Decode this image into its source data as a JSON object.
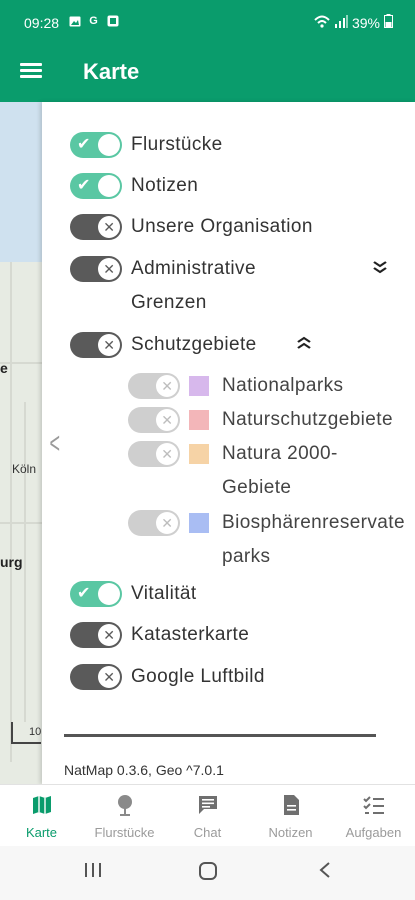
{
  "status": {
    "time": "09:28",
    "battery": "39%",
    "icons": [
      "image-icon",
      "g-icon",
      "app-icon"
    ]
  },
  "appbar": {
    "title": "Karte"
  },
  "map": {
    "labels": [
      "e",
      "Köln",
      "urg"
    ],
    "scale": "10"
  },
  "layers": [
    {
      "label": "Flurstücke",
      "state": "on"
    },
    {
      "label": "Notizen",
      "state": "on"
    },
    {
      "label": "Unsere Organisation",
      "state": "off"
    },
    {
      "label": "Administrative Grenzen",
      "state": "off",
      "chevron": "expand"
    },
    {
      "label": "Schutzgebiete",
      "state": "off",
      "chevron": "collapse"
    },
    {
      "label": "Vitalität",
      "state": "on"
    },
    {
      "label": "Katasterkarte",
      "state": "off"
    },
    {
      "label": "Google Luftbild",
      "state": "off"
    }
  ],
  "sublayers": [
    {
      "label": "Nationalparks",
      "color": "#d7b8ec"
    },
    {
      "label": "Naturschutzgebiete",
      "color": "#f3b6b9"
    },
    {
      "label": "Natura 2000-Gebiete",
      "color": "#f6d3a6"
    },
    {
      "label": "Biosphärenreservate parks",
      "color": "#a9bdf3"
    }
  ],
  "version": "NatMap 0.3.6, Geo ^7.0.1",
  "nav": [
    {
      "label": "Karte",
      "icon": "map-icon",
      "active": true
    },
    {
      "label": "Flurstücke",
      "icon": "tree-icon",
      "active": false
    },
    {
      "label": "Chat",
      "icon": "chat-icon",
      "active": false
    },
    {
      "label": "Notizen",
      "icon": "document-icon",
      "active": false
    },
    {
      "label": "Aufgaben",
      "icon": "checklist-icon",
      "active": false
    }
  ],
  "colors": {
    "primary": "#0a9c6c",
    "toggle_on": "#5ac7a3",
    "toggle_off": "#5a5a5a"
  }
}
